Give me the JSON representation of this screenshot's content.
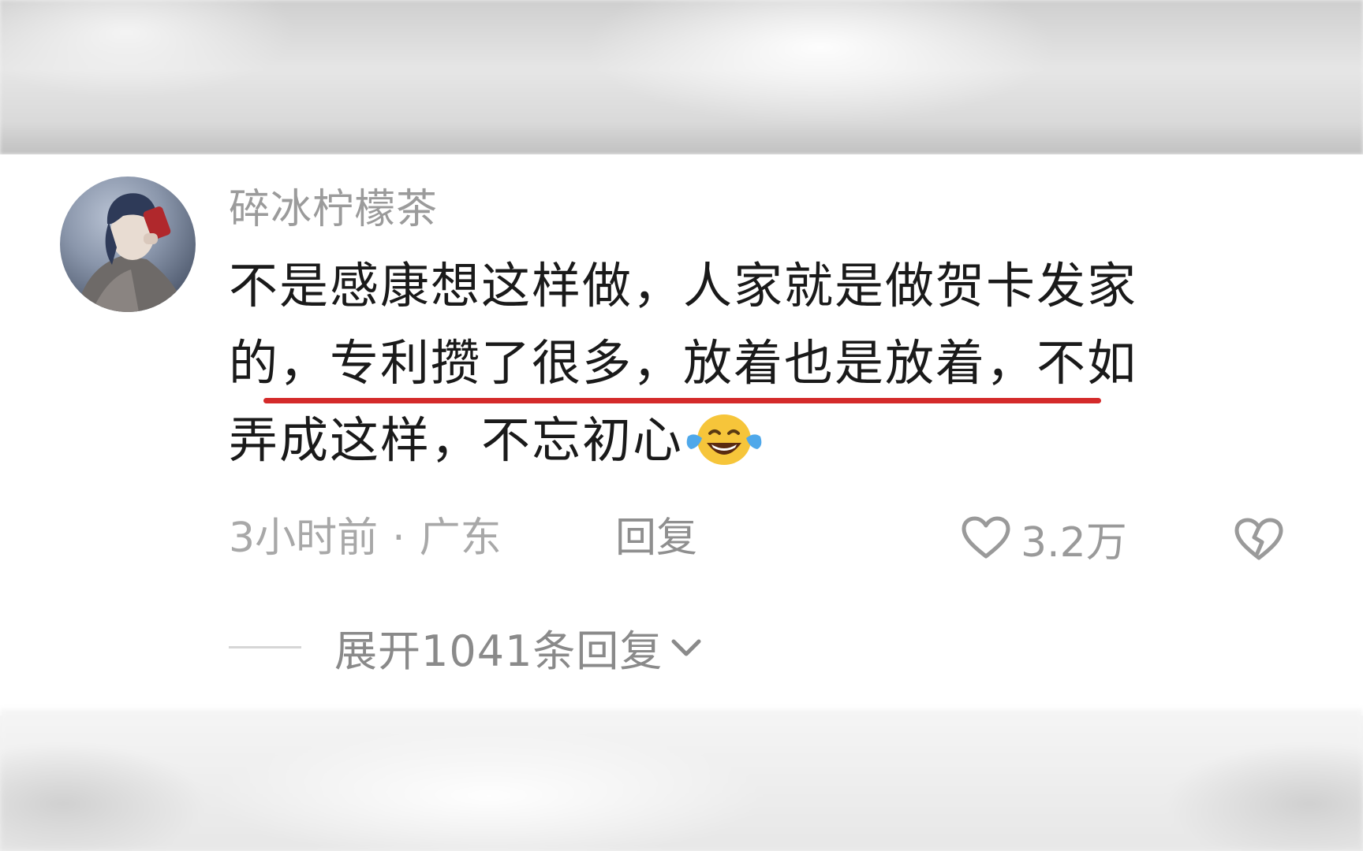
{
  "comment": {
    "username": "碎冰柠檬茶",
    "content_lines": [
      "不是感康想这样做，人家就是做贺卡发家",
      "的，专利攒了很多，放着也是放着，不如",
      "弄成这样，不忘初心"
    ],
    "time": "3小时前",
    "separator": "·",
    "location": "广东",
    "reply_label": "回复",
    "like_count": "3.2万",
    "expand_label": "展开1041条回复",
    "emoji": "face-with-tears-of-joy",
    "highlight_color": "#d42a2a"
  }
}
